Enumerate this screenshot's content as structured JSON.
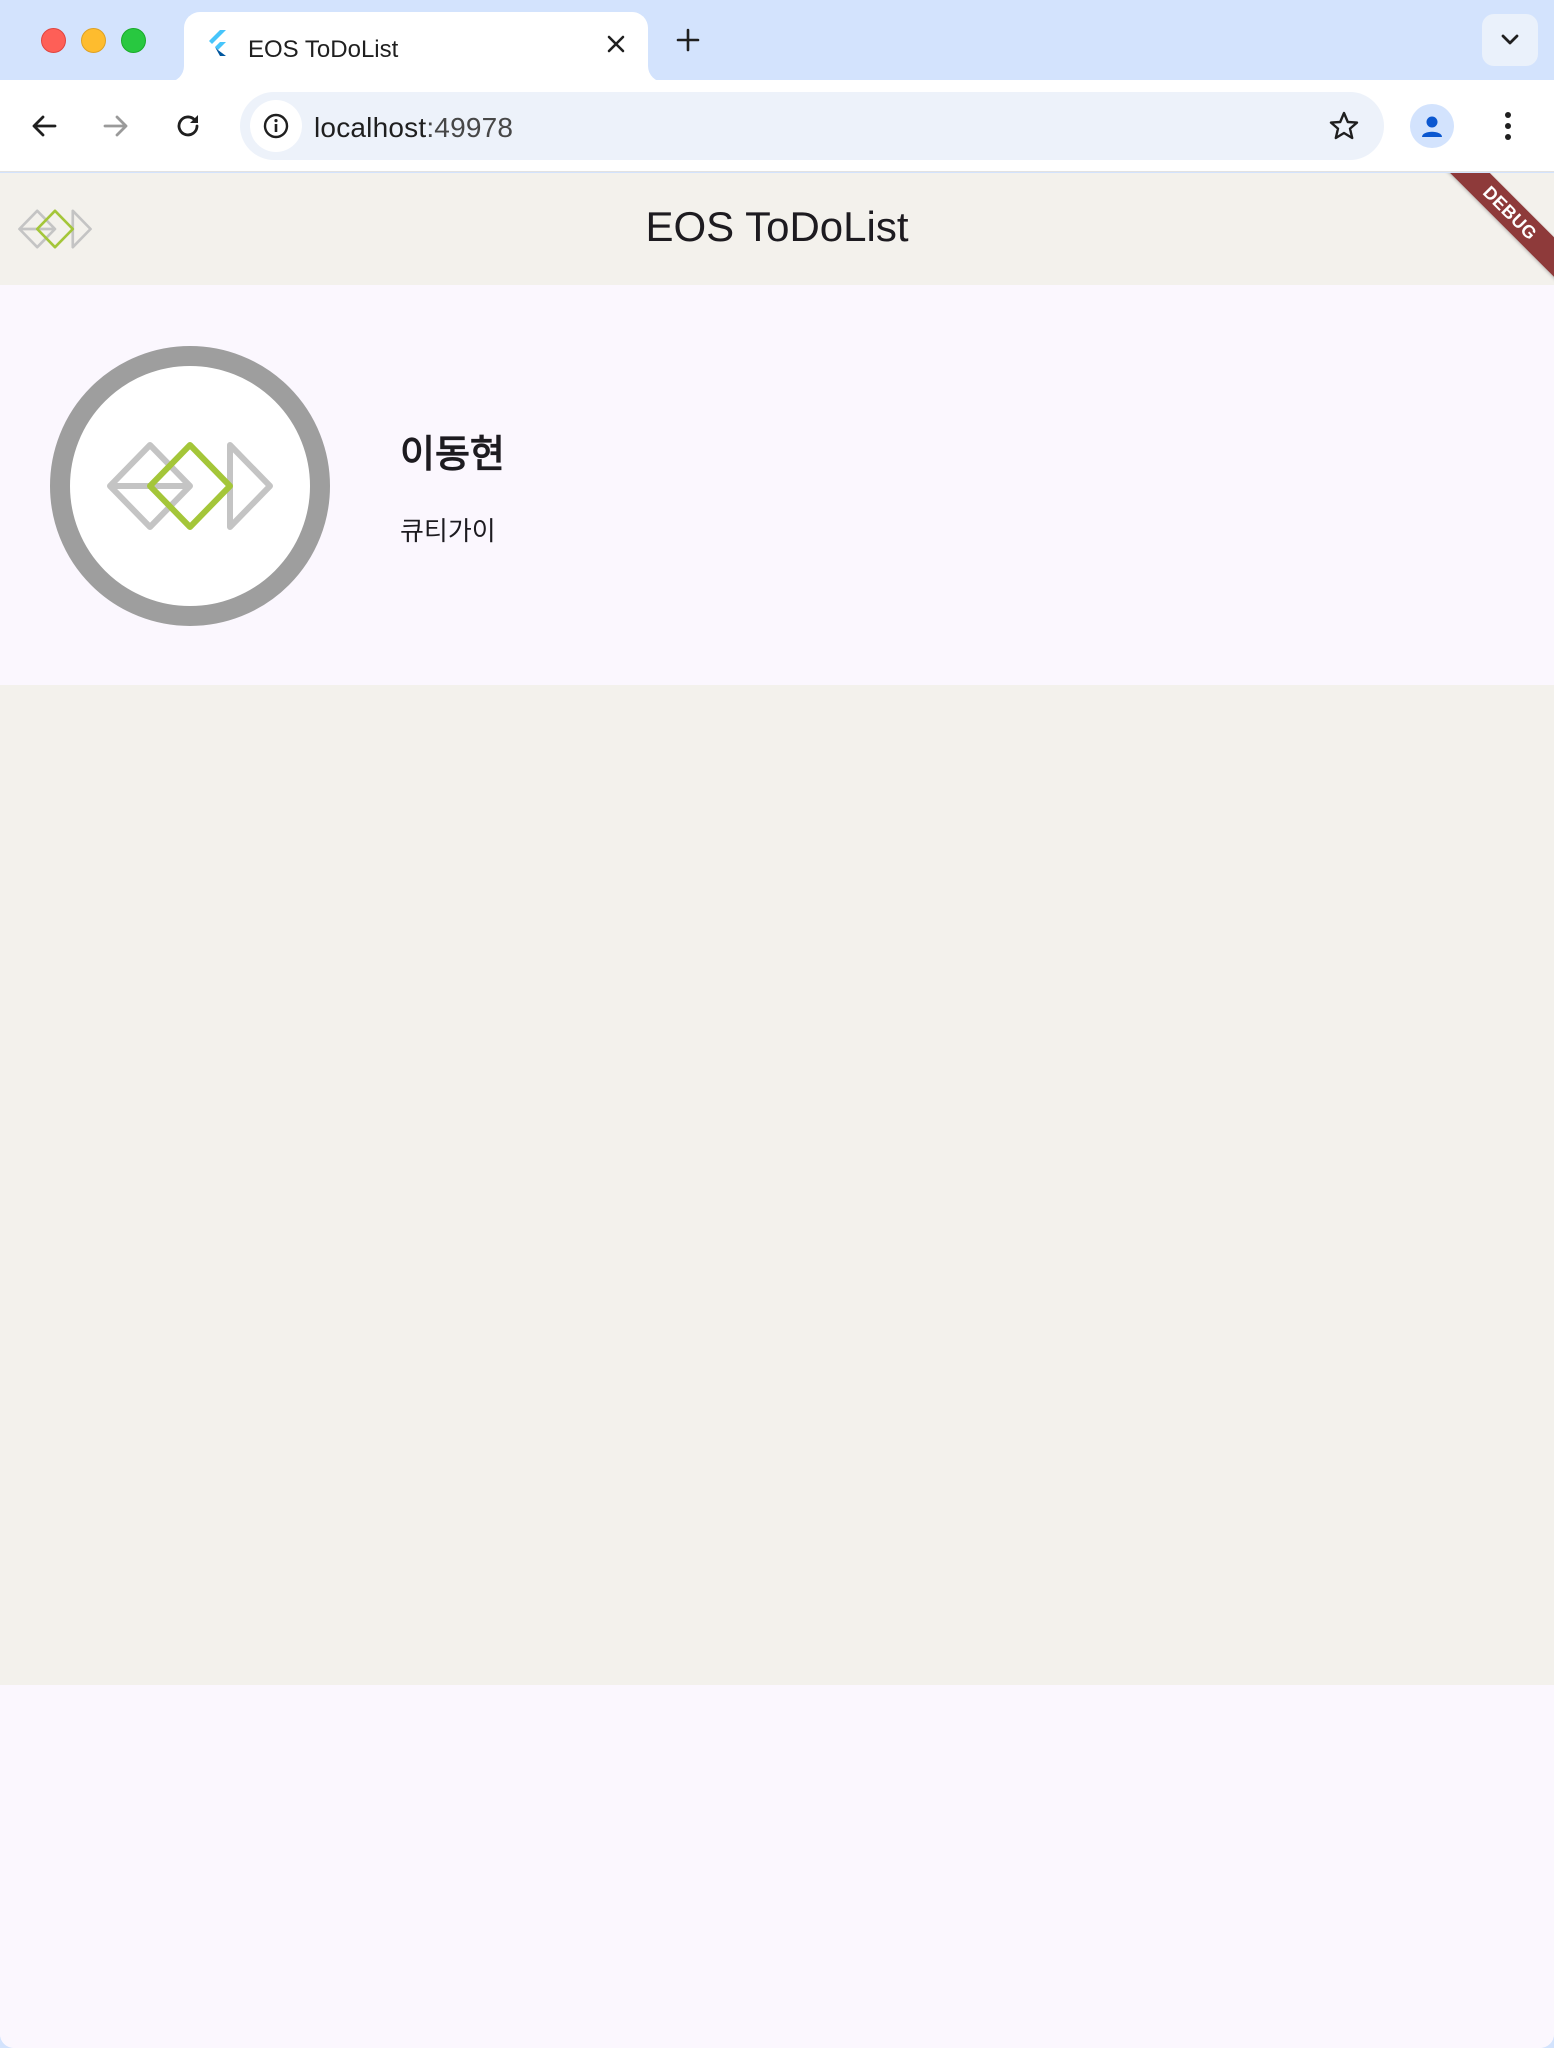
{
  "browser": {
    "tab": {
      "title": "EOS ToDoList",
      "favicon": "flutter-icon"
    },
    "address_bar": {
      "host": "localhost",
      "port": ":49978"
    },
    "icons": {
      "back": "back-arrow-icon",
      "forward": "forward-arrow-icon",
      "reload": "reload-icon",
      "site_info": "info-icon",
      "bookmark": "star-icon",
      "profile": "profile-icon",
      "menu": "kebab-menu-icon",
      "new_tab": "plus-icon",
      "close_tab": "close-icon",
      "tab_search": "chevron-down-icon"
    }
  },
  "app": {
    "title": "EOS ToDoList",
    "debug_banner": "DEBUG",
    "logo": "eos-diamond-logo",
    "profile": {
      "name": "이동현",
      "role": "큐티가이"
    },
    "colors": {
      "appbar_bg": "#f3f1ec",
      "surface_bg": "#fbf7fe",
      "logo_green": "#a4c639",
      "logo_gray": "#c4c4c4",
      "avatar_ring": "#9e9e9e",
      "debug_banner": "#8e3a3a"
    }
  }
}
